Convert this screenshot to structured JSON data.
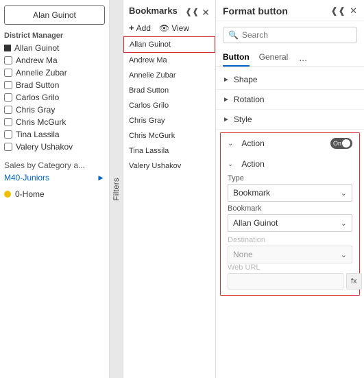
{
  "left": {
    "button_label": "Alan Guinot",
    "section_title": "District Manager",
    "checkboxes": [
      {
        "label": "Allan Guinot",
        "filled": true,
        "checked": false
      },
      {
        "label": "Andrew Ma",
        "filled": false,
        "checked": false
      },
      {
        "label": "Annelie Zubar",
        "filled": false,
        "checked": false
      },
      {
        "label": "Brad Sutton",
        "filled": false,
        "checked": false
      },
      {
        "label": "Carlos Grilo",
        "filled": false,
        "checked": false
      },
      {
        "label": "Chris Gray",
        "filled": false,
        "checked": false
      },
      {
        "label": "Chris McGurk",
        "filled": false,
        "checked": false
      },
      {
        "label": "Tina Lassila",
        "filled": false,
        "checked": false
      },
      {
        "label": "Valery Ushakov",
        "filled": false,
        "checked": false
      }
    ],
    "sales_label": "Sales by Category a...",
    "m40_label": "M40-Juniors",
    "home_label": "0-Home"
  },
  "bookmarks": {
    "title": "Bookmarks",
    "add_label": "Add",
    "view_label": "View",
    "filters_label": "Filters",
    "items": [
      {
        "label": "Allan Guinot",
        "selected": true
      },
      {
        "label": "Andrew Ma",
        "selected": false
      },
      {
        "label": "Annelie Zubar",
        "selected": false
      },
      {
        "label": "Brad Sutton",
        "selected": false
      },
      {
        "label": "Carlos Grilo",
        "selected": false
      },
      {
        "label": "Chris Gray",
        "selected": false
      },
      {
        "label": "Chris McGurk",
        "selected": false
      },
      {
        "label": "Tina Lassila",
        "selected": false
      },
      {
        "label": "Valery Ushakov",
        "selected": false
      }
    ]
  },
  "format": {
    "title": "Format button",
    "search_placeholder": "Search",
    "tabs": [
      "Button",
      "General"
    ],
    "more_label": "...",
    "shape_label": "Shape",
    "rotation_label": "Rotation",
    "style_label": "Style",
    "action_label": "Action",
    "toggle_on_label": "On",
    "sub_action_label": "Action",
    "type_label": "Type",
    "type_value": "Bookmark",
    "bookmark_label": "Bookmark",
    "bookmark_value": "Allan Guinot",
    "destination_label": "Destination",
    "destination_value": "None",
    "weburl_label": "Web URL",
    "weburl_value": "",
    "fx_label": "fx",
    "active_tab": "Button"
  }
}
